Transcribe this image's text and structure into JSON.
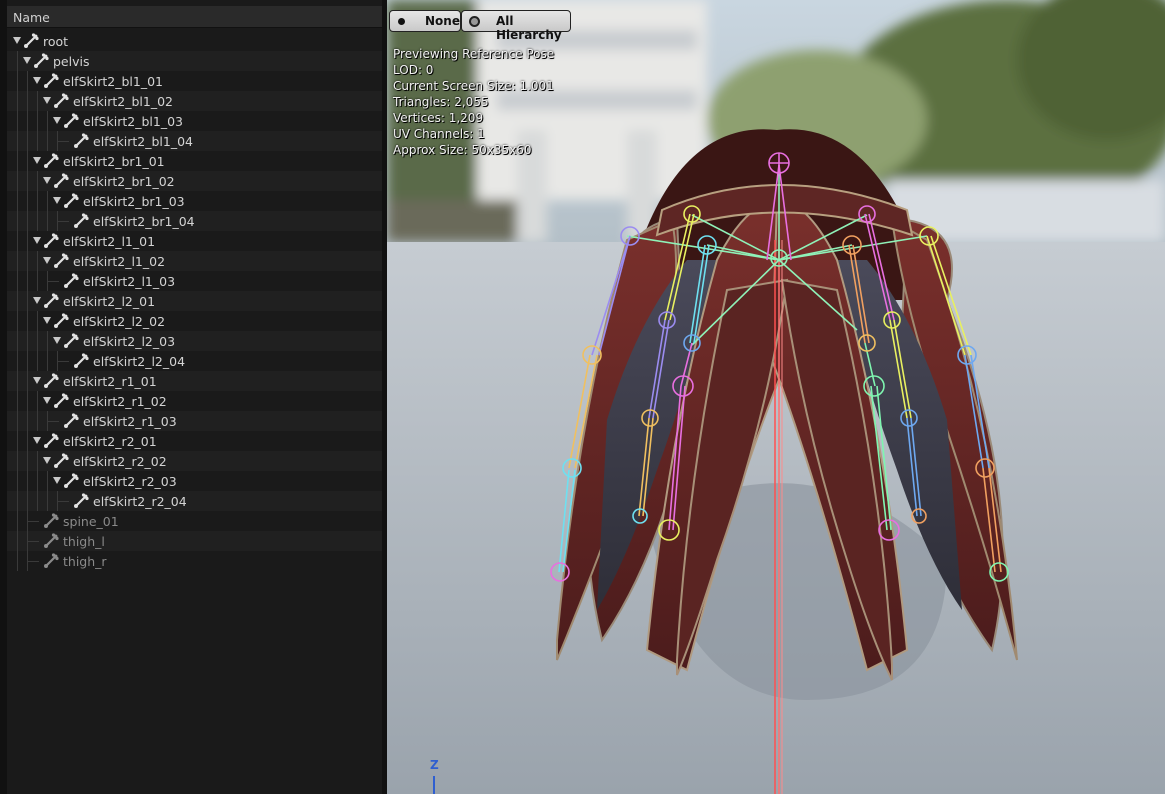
{
  "tree": {
    "header": "Name",
    "rows": [
      {
        "label": "root",
        "depth": 0,
        "expandable": true,
        "faded": false
      },
      {
        "label": "pelvis",
        "depth": 1,
        "expandable": true,
        "faded": false
      },
      {
        "label": "elfSkirt2_bl1_01",
        "depth": 2,
        "expandable": true,
        "faded": false
      },
      {
        "label": "elfSkirt2_bl1_02",
        "depth": 3,
        "expandable": true,
        "faded": false
      },
      {
        "label": "elfSkirt2_bl1_03",
        "depth": 4,
        "expandable": true,
        "faded": false
      },
      {
        "label": "elfSkirt2_bl1_04",
        "depth": 5,
        "expandable": false,
        "faded": false
      },
      {
        "label": "elfSkirt2_br1_01",
        "depth": 2,
        "expandable": true,
        "faded": false
      },
      {
        "label": "elfSkirt2_br1_02",
        "depth": 3,
        "expandable": true,
        "faded": false
      },
      {
        "label": "elfSkirt2_br1_03",
        "depth": 4,
        "expandable": true,
        "faded": false
      },
      {
        "label": "elfSkirt2_br1_04",
        "depth": 5,
        "expandable": false,
        "faded": false
      },
      {
        "label": "elfSkirt2_l1_01",
        "depth": 2,
        "expandable": true,
        "faded": false
      },
      {
        "label": "elfSkirt2_l1_02",
        "depth": 3,
        "expandable": true,
        "faded": false
      },
      {
        "label": "elfSkirt2_l1_03",
        "depth": 4,
        "expandable": false,
        "faded": false
      },
      {
        "label": "elfSkirt2_l2_01",
        "depth": 2,
        "expandable": true,
        "faded": false
      },
      {
        "label": "elfSkirt2_l2_02",
        "depth": 3,
        "expandable": true,
        "faded": false
      },
      {
        "label": "elfSkirt2_l2_03",
        "depth": 4,
        "expandable": true,
        "faded": false
      },
      {
        "label": "elfSkirt2_l2_04",
        "depth": 5,
        "expandable": false,
        "faded": false
      },
      {
        "label": "elfSkirt2_r1_01",
        "depth": 2,
        "expandable": true,
        "faded": false
      },
      {
        "label": "elfSkirt2_r1_02",
        "depth": 3,
        "expandable": true,
        "faded": false
      },
      {
        "label": "elfSkirt2_r1_03",
        "depth": 4,
        "expandable": false,
        "faded": false
      },
      {
        "label": "elfSkirt2_r2_01",
        "depth": 2,
        "expandable": true,
        "faded": false
      },
      {
        "label": "elfSkirt2_r2_02",
        "depth": 3,
        "expandable": true,
        "faded": false
      },
      {
        "label": "elfSkirt2_r2_03",
        "depth": 4,
        "expandable": true,
        "faded": false
      },
      {
        "label": "elfSkirt2_r2_04",
        "depth": 5,
        "expandable": false,
        "faded": false
      },
      {
        "label": "spine_01",
        "depth": 2,
        "expandable": false,
        "faded": true
      },
      {
        "label": "thigh_l",
        "depth": 2,
        "expandable": false,
        "faded": true
      },
      {
        "label": "thigh_r",
        "depth": 2,
        "expandable": false,
        "faded": true
      }
    ]
  },
  "toolbar": {
    "none_label": "None",
    "hierarchy_label": "All Hierarchy"
  },
  "stats": {
    "preview": "Previewing Reference Pose",
    "lod": "LOD: 0",
    "screen_size": "Current Screen Size: 1.001",
    "triangles": "Triangles: 2,055",
    "vertices": "Vertices: 1,209",
    "uv_channels": "UV Channels: 1",
    "approx_size": "Approx Size: 50x35x60"
  },
  "axis": {
    "z_label": "Z"
  },
  "icons": {
    "bone": "bone-icon",
    "expand": "expand-arrow-icon"
  },
  "colors": {
    "panel_bg": "#1a1a1a",
    "viewport_floor": "#aab2ba",
    "skirt": "#6a2a28",
    "bone_pink": "#e86fe0",
    "bone_green": "#7ff5b0",
    "bone_yellow": "#e8f060",
    "bone_blue": "#6a9cf0",
    "bone_orange": "#f0a060",
    "axis_red": "#ff4a4a",
    "axis_blue": "#2f5fd0"
  }
}
